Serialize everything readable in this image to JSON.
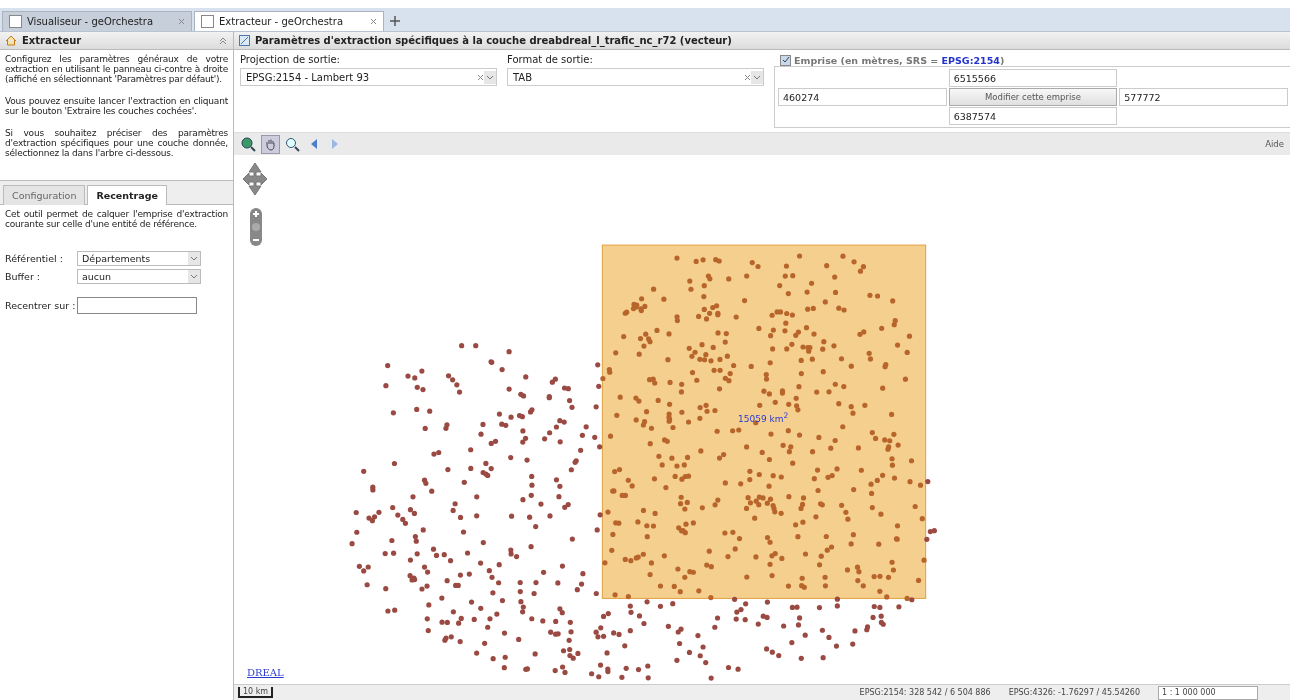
{
  "browser_tabs": [
    {
      "title": "Visualiseur - geOrchestra",
      "selected": false
    },
    {
      "title": "Extracteur - geOrchestra",
      "selected": true
    }
  ],
  "left_panel": {
    "title": "Extracteur",
    "paragraphs": [
      "Configurez les paramètres généraux de votre extraction en utilisant le panneau ci-contre à droite (affiché en sélectionnant 'Paramètres par défaut').",
      "Vous pouvez ensuite lancer l'extraction en cliquant sur le bouton 'Extraire les couches cochées'.",
      "Si vous souhaitez préciser des paramètres d'extraction spécifiques pour une couche donnée, sélectionnez la dans l'arbre ci-dessous."
    ],
    "tabs": [
      {
        "label": "Configuration",
        "selected": false
      },
      {
        "label": "Recentrage",
        "selected": true
      }
    ],
    "description": "Cet outil permet de calquer l'emprise d'extraction courante sur celle d'une entité de référence.",
    "selects": [
      {
        "label": "Référentiel :",
        "value": "Départements"
      },
      {
        "label": "Buffer :",
        "value": "aucun"
      }
    ],
    "recenter": {
      "label": "Recentrer sur :"
    }
  },
  "main_panel": {
    "title": "Paramètres d'extraction spécifiques à la couche dreabdreal_l_trafic_nc_r72 (vecteur)",
    "projection": {
      "label": "Projection de sortie:",
      "value": "EPSG:2154 - Lambert 93"
    },
    "format": {
      "label": "Format de sortie:",
      "value": "TAB"
    },
    "extent": {
      "checked": true,
      "legend": "Emprise (en mètres, SRS = ",
      "srs": "EPSG:2154",
      "legend_end": ")",
      "north": "6515566",
      "west": "460274",
      "east": "577772",
      "south": "6387574",
      "button": "Modifier cette emprise"
    },
    "help": "Aide"
  },
  "map": {
    "area_label": "15059 km$^{2}$",
    "attribution": "DREAL"
  },
  "status_bar": {
    "scale_bar": "10 km",
    "coords_2154": "EPSG:2154: 328 542 / 6 504 886",
    "coords_4326": "EPSG:4326: -1.76297 / 45.54260",
    "scale": "1 : 1 000 000"
  }
}
